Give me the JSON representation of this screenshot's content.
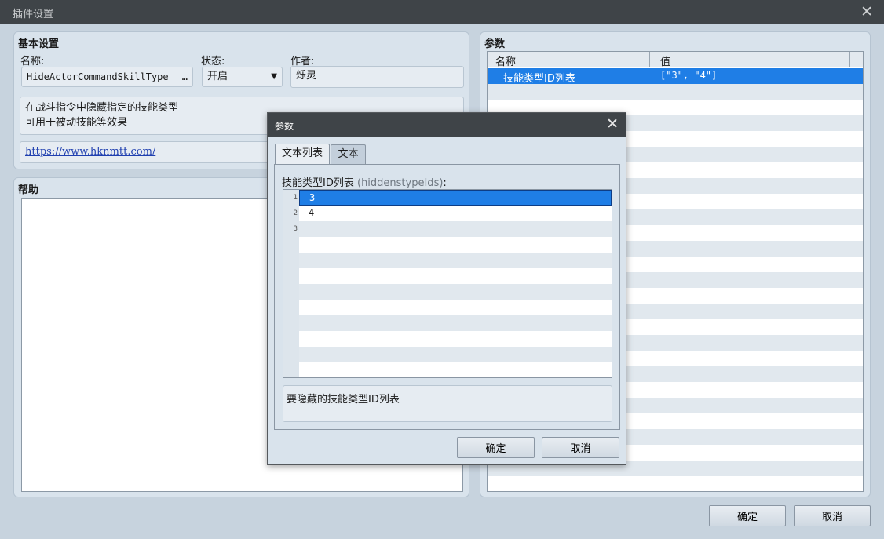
{
  "window": {
    "title": "插件设置",
    "close": "✕"
  },
  "basic": {
    "title": "基本设置",
    "name_label": "名称:",
    "name_value": "HideActorCommandSkillType",
    "name_ellipsis": "…",
    "status_label": "状态:",
    "status_value": "开启",
    "status_arrow": "▼",
    "author_label": "作者:",
    "author_value": "烁灵",
    "description_line1": "在战斗指令中隐藏指定的技能类型",
    "description_line2": "可用于被动技能等效果",
    "url": "https://www.hknmtt.com/"
  },
  "help": {
    "title": "帮助"
  },
  "params": {
    "title": "参数",
    "col_name": "名称",
    "col_value": "值",
    "rows": [
      {
        "name": "技能类型ID列表",
        "value": "[\"3\", \"4\"]"
      }
    ]
  },
  "footer": {
    "ok": "确定",
    "cancel": "取消"
  },
  "dialog": {
    "title": "参数",
    "close": "✕",
    "tabs": [
      "文本列表",
      "文本"
    ],
    "field_label": "技能类型ID列表",
    "field_key": "(hiddenstypeIds)",
    "field_colon": ":",
    "lines": [
      {
        "no": "1",
        "text": "3"
      },
      {
        "no": "2",
        "text": "4"
      },
      {
        "no": "3",
        "text": ""
      }
    ],
    "description": "要隐藏的技能类型ID列表",
    "ok": "确定",
    "cancel": "取消"
  },
  "colors": {
    "selection": "#1f7ee6",
    "titlebar": "#3f4448",
    "panel": "#d9e3ec"
  }
}
